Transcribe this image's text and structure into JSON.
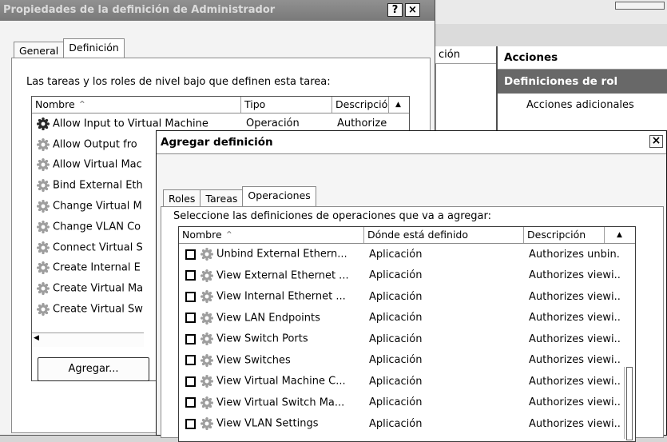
{
  "back_window": {
    "title": "Propiedades de la definición de Administrador",
    "help_btn": "?",
    "close_btn": "×",
    "tabs": [
      "General",
      "Definición"
    ],
    "description": "Las tareas y los roles de nivel bajo que definen esta tarea:",
    "columns": [
      "Nombre",
      "Tipo",
      "Descripció"
    ],
    "rows": [
      {
        "name": "Allow Input to Virtual Machine",
        "type": "Operación",
        "desc": "Authorize"
      },
      {
        "name": "Allow Output fro"
      },
      {
        "name": "Allow Virtual Mac"
      },
      {
        "name": "Bind External Eth"
      },
      {
        "name": "Change Virtual M"
      },
      {
        "name": "Change VLAN Co"
      },
      {
        "name": "Connect Virtual S"
      },
      {
        "name": "Create Internal E"
      },
      {
        "name": "Create Virtual Ma"
      },
      {
        "name": "Create Virtual Sw"
      }
    ],
    "add_button": "Agregar..."
  },
  "mmc": {
    "col_header": "ción",
    "actions_header": "Acciones",
    "section": "Definiciones de rol",
    "more_actions": "Acciones adicionales"
  },
  "front_dialog": {
    "title": "Agregar definición",
    "close_btn": "×",
    "tabs": [
      "Roles",
      "Tareas",
      "Operaciones"
    ],
    "active_tab": 2,
    "instruction": "Seleccione las definiciones de operaciones que va a agregar:",
    "columns": [
      "Nombre",
      "Dónde está definido",
      "Descripción"
    ],
    "rows": [
      {
        "name": "Unbind External Ethern...",
        "where": "Aplicación",
        "desc": "Authorizes unbin..."
      },
      {
        "name": "View External Ethernet ...",
        "where": "Aplicación",
        "desc": "Authorizes viewi..."
      },
      {
        "name": "View Internal Ethernet ...",
        "where": "Aplicación",
        "desc": "Authorizes viewi..."
      },
      {
        "name": "View LAN Endpoints",
        "where": "Aplicación",
        "desc": "Authorizes viewi..."
      },
      {
        "name": "View Switch Ports",
        "where": "Aplicación",
        "desc": "Authorizes viewi..."
      },
      {
        "name": "View Switches",
        "where": "Aplicación",
        "desc": "Authorizes viewi..."
      },
      {
        "name": "View Virtual Machine C...",
        "where": "Aplicación",
        "desc": "Authorizes viewi..."
      },
      {
        "name": "View Virtual Switch Ma...",
        "where": "Aplicación",
        "desc": "Authorizes viewi..."
      },
      {
        "name": "View VLAN Settings",
        "where": "Aplicación",
        "desc": "Authorizes viewi..."
      }
    ]
  }
}
